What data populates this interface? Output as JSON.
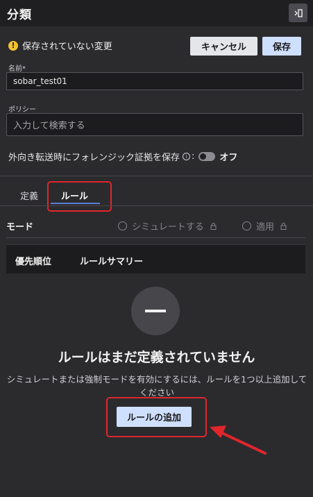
{
  "header": {
    "title": "分類",
    "collapse_icon": "panel-collapse-icon"
  },
  "unsaved": {
    "icon": "!",
    "text": "保存されていない変更"
  },
  "actions": {
    "cancel_label": "キャンセル",
    "save_label": "保存"
  },
  "name_field": {
    "label": "名前",
    "required_mark": "*",
    "value": "sobar_test01"
  },
  "policy_field": {
    "label": "ポリシー",
    "placeholder": "入力して検索する"
  },
  "forensic": {
    "label": "外向き転送時にフォレンジック証拠を保存",
    "info_icon": "i",
    "suffix": ":",
    "toggle_state": "オフ"
  },
  "tabs": [
    {
      "label": "定義",
      "active": false
    },
    {
      "label": "ルール",
      "active": true
    }
  ],
  "mode": {
    "label": "モード",
    "options": [
      {
        "label": "シミュレートする",
        "disabled": true
      },
      {
        "label": "適用",
        "disabled": true
      }
    ]
  },
  "table": {
    "columns": [
      "優先順位",
      "ルールサマリー"
    ]
  },
  "empty_state": {
    "icon": "minus-icon",
    "title": "ルールはまだ定義されていません",
    "description": "シミュレートまたは強制モードを有効にするには、ルールを1つ以上追加してください",
    "add_button_label": "ルールの追加"
  },
  "colors": {
    "accent": "#5b7ed9",
    "highlight": "#e0262b",
    "primary_button": "#cfe0ff"
  }
}
